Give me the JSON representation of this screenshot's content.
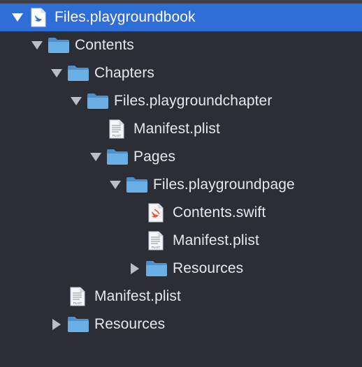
{
  "tree": {
    "root": {
      "label": "Files.playgroundbook"
    },
    "contents": {
      "label": "Contents"
    },
    "chapters": {
      "label": "Chapters"
    },
    "chapter": {
      "label": "Files.playgroundchapter"
    },
    "chapter_manifest": {
      "label": "Manifest.plist",
      "icon_text": "PLIST"
    },
    "pages": {
      "label": "Pages"
    },
    "page": {
      "label": "Files.playgroundpage"
    },
    "contents_swift": {
      "label": "Contents.swift"
    },
    "page_manifest": {
      "label": "Manifest.plist",
      "icon_text": "PLIST"
    },
    "page_resources": {
      "label": "Resources"
    },
    "contents_manifest": {
      "label": "Manifest.plist",
      "icon_text": "PLIST"
    },
    "contents_resources": {
      "label": "Resources"
    }
  },
  "colors": {
    "background": "#2b2e35",
    "selection": "#2f6ed6",
    "folder": "#6aaee6",
    "text": "#e6e8ec"
  },
  "icons": {
    "expanded": "disclosure-triangle-down-icon",
    "collapsed": "disclosure-triangle-right-icon",
    "folder": "folder-icon",
    "plist": "plist-file-icon",
    "swift": "swift-file-icon",
    "playground": "playground-book-icon"
  }
}
